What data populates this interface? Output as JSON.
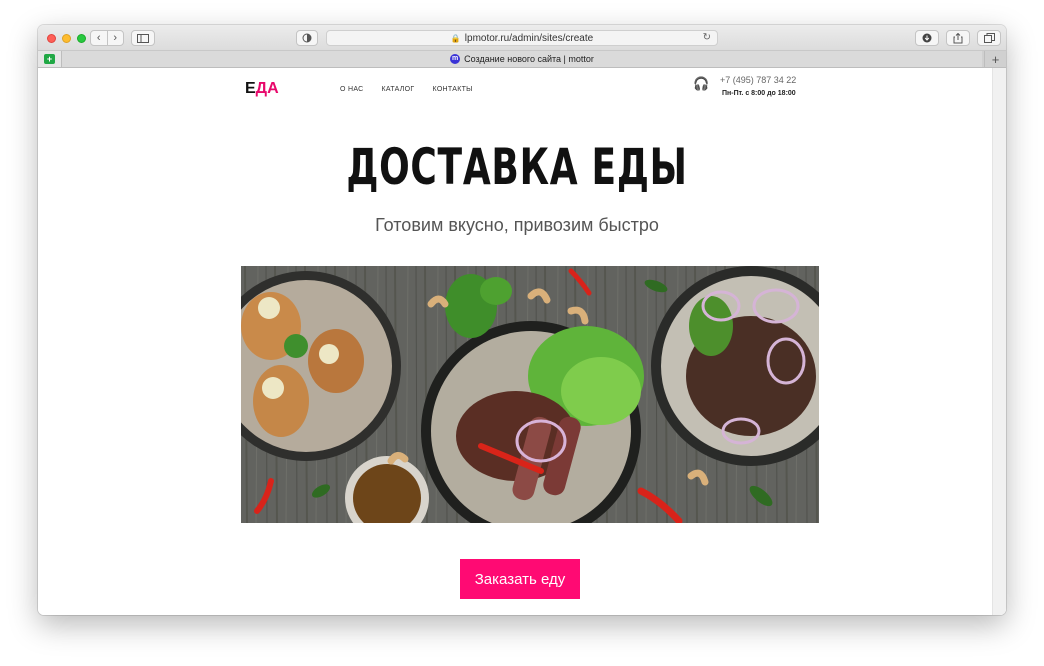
{
  "browser": {
    "url": "lpmotor.ru/admin/sites/create",
    "tab_title": "Создание нового сайта | mottor",
    "favicon_letter": "m",
    "pinned_tab_icon": "green-plus-icon"
  },
  "site": {
    "logo_part1": "Е",
    "logo_part2": "ДА",
    "logo_accent_color": "#e8086b",
    "nav": [
      "О НАС",
      "КАТАЛОГ",
      "КОНТАКТЫ"
    ],
    "phone": "+7 (495) 787 34 22",
    "hours": "Пн-Пт. с 8:00 до 18:00",
    "title": "ДОСТАВКА ЕДЫ",
    "subtitle": "Готовим вкусно, привозим быстро",
    "cta_label": "Заказать еду",
    "cta_color": "#ff0a73"
  }
}
